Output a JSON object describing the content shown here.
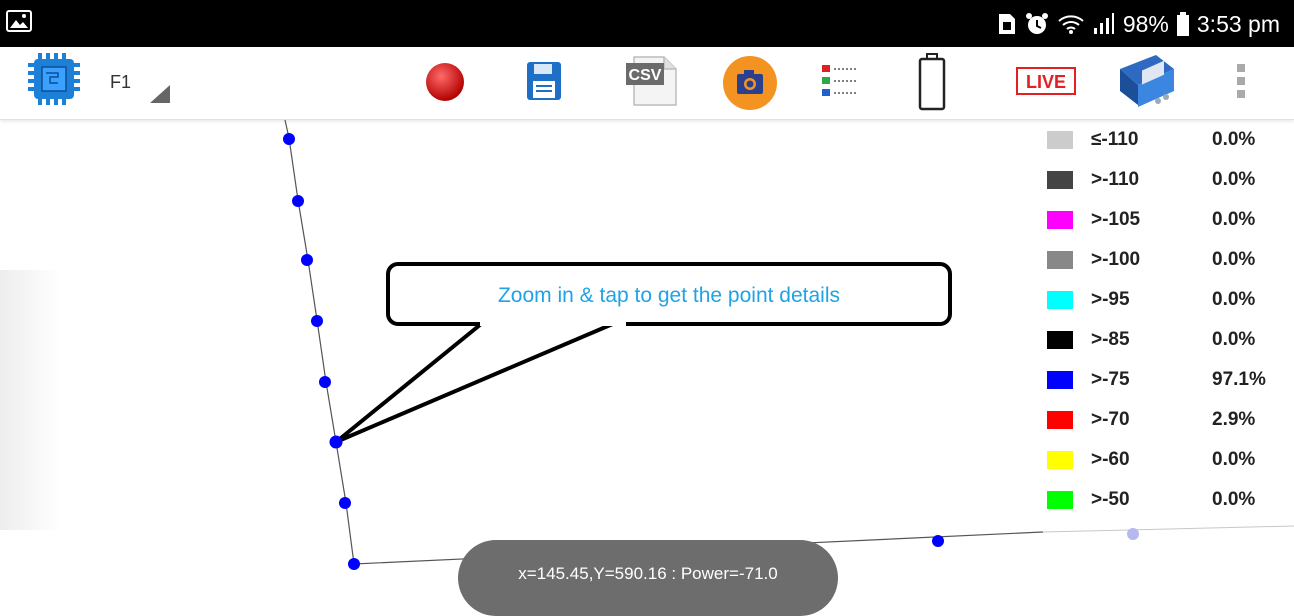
{
  "status_bar": {
    "battery_percent": "98%",
    "time": "3:53 pm",
    "icons": [
      "image-icon",
      "sim-icon",
      "alarm-icon",
      "wifi-icon",
      "signal-icon",
      "battery-icon"
    ]
  },
  "toolbar": {
    "profile_label": "F1",
    "csv_label": "CSV",
    "live_label": "LIVE",
    "icons": [
      "chip-icon",
      "record-icon",
      "save-icon",
      "csv-icon",
      "camera-icon",
      "legend-list-icon",
      "battery-outline-icon",
      "live-icon",
      "scanner-device-icon",
      "overflow-menu-icon"
    ],
    "colors": {
      "record": "#d10000",
      "save": "#1f6fc6",
      "camera": "#f39321",
      "live": "#e12121"
    }
  },
  "legend": {
    "items": [
      {
        "label": "≤-110",
        "pct": "0.0%",
        "color": "#cccccc"
      },
      {
        "label": ">-110",
        "pct": "0.0%",
        "color": "#444444"
      },
      {
        "label": ">-105",
        "pct": "0.0%",
        "color": "#ff00ff"
      },
      {
        "label": ">-100",
        "pct": "0.0%",
        "color": "#888888"
      },
      {
        "label": ">-95",
        "pct": "0.0%",
        "color": "#00ffff"
      },
      {
        "label": ">-85",
        "pct": "0.0%",
        "color": "#000000"
      },
      {
        "label": ">-75",
        "pct": "97.1%",
        "color": "#0000ff"
      },
      {
        "label": ">-70",
        "pct": "2.9%",
        "color": "#ff0000"
      },
      {
        "label": ">-60",
        "pct": "0.0%",
        "color": "#ffff00"
      },
      {
        "label": ">-50",
        "pct": "0.0%",
        "color": "#00ff00"
      }
    ]
  },
  "callout": {
    "text": "Zoom in & tap to get the point details"
  },
  "toast": {
    "text": "x=145.45,Y=590.16 : Power=-71.0"
  },
  "plot": {
    "point_color": "#0000ff",
    "line_color": "#555555"
  }
}
